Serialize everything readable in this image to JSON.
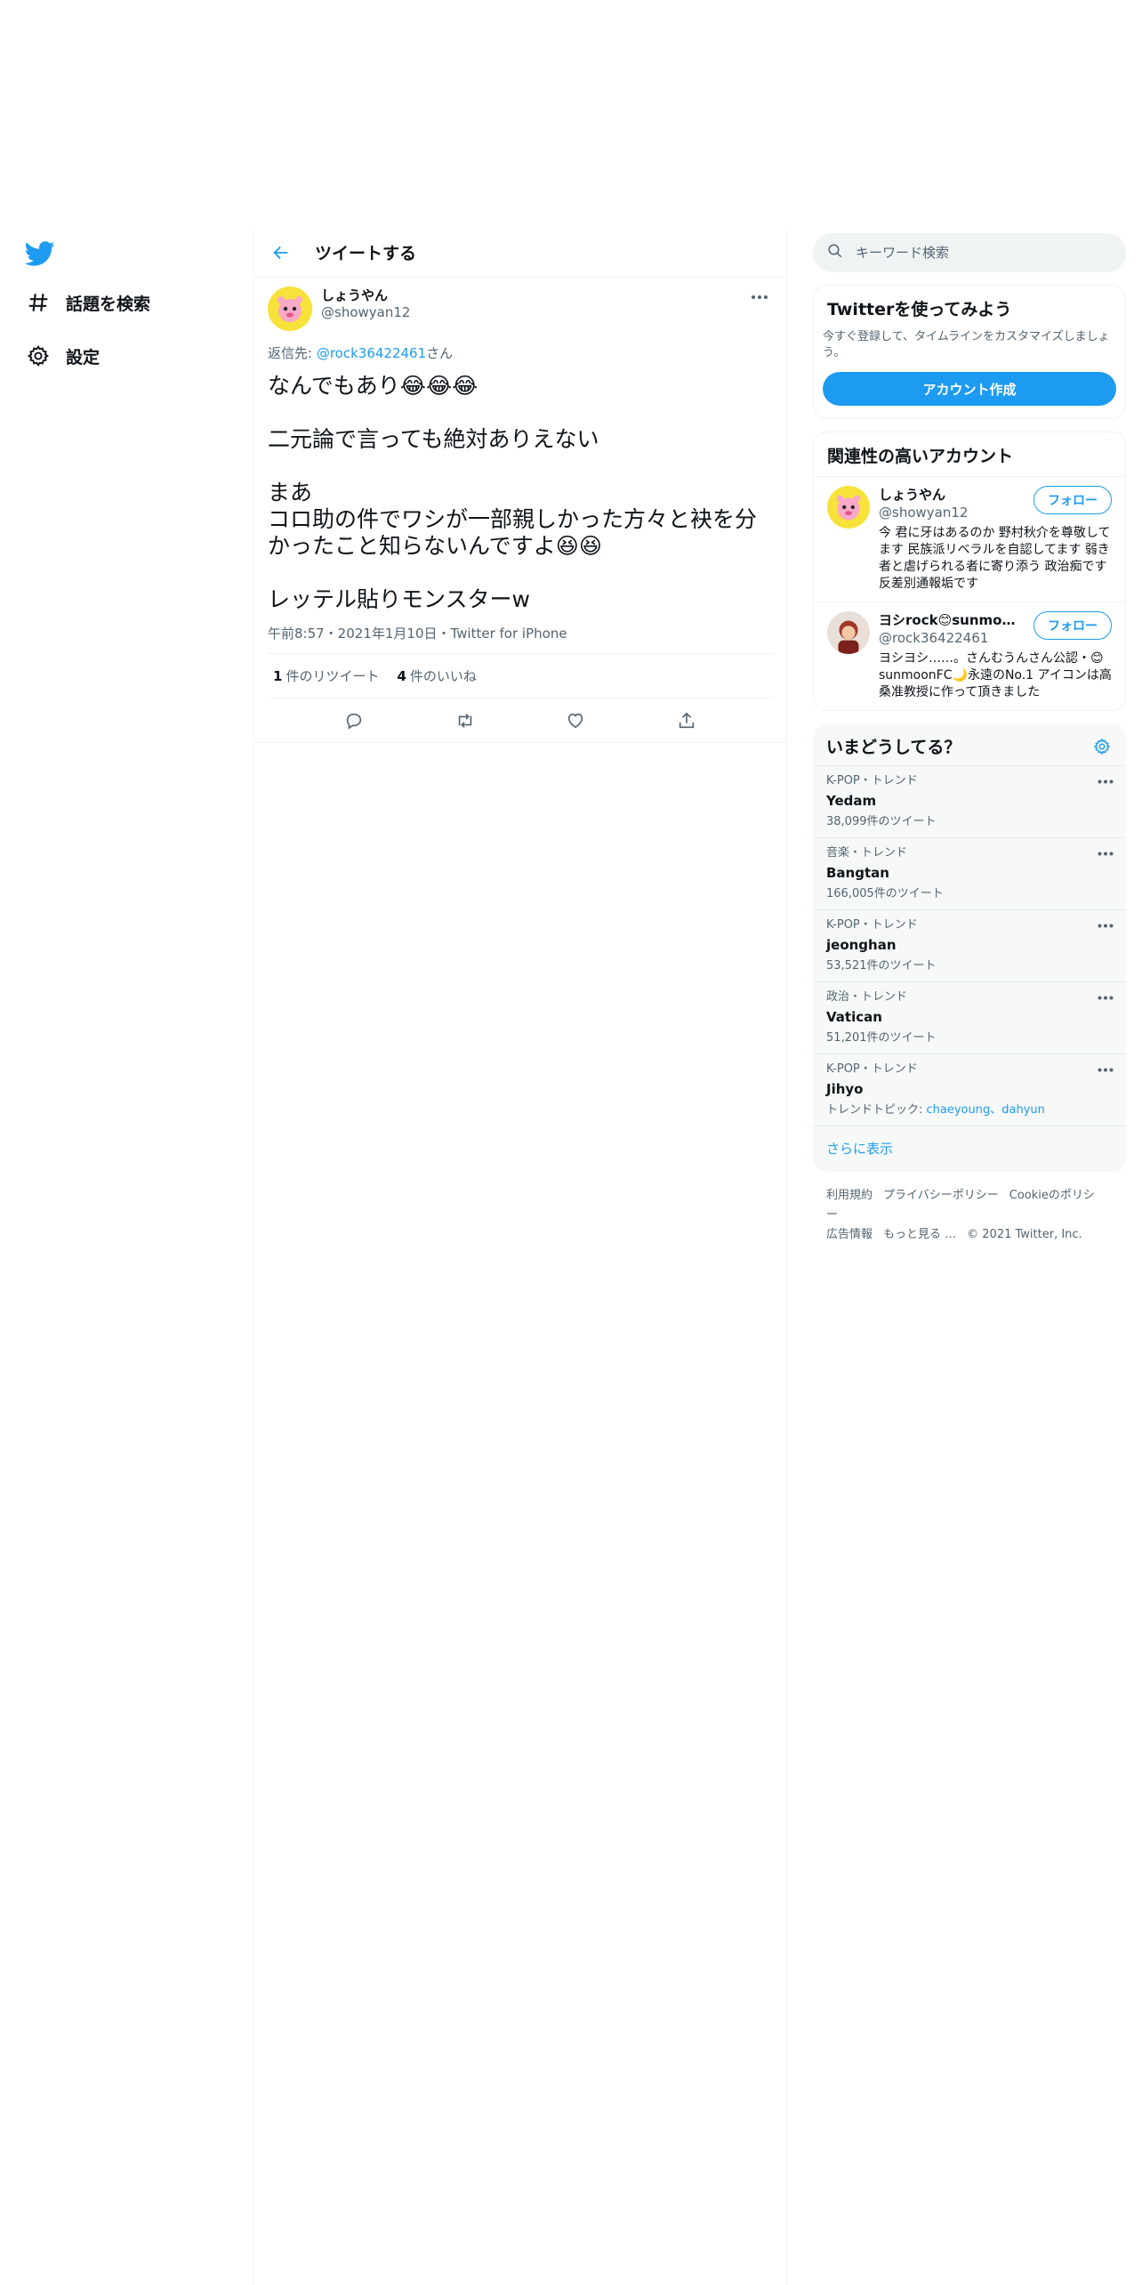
{
  "nav": {
    "items": [
      {
        "label": "話題を検索",
        "icon": "hashtag-icon"
      },
      {
        "label": "設定",
        "icon": "gear-icon"
      }
    ]
  },
  "header": {
    "title": "ツイートする"
  },
  "tweet": {
    "author_name": "しょうやん",
    "author_handle": "@showyan12",
    "reply_prefix": "返信先: ",
    "reply_handle": "@rock36422461",
    "reply_suffix": "さん",
    "text": "なんでもあり😂😂😂\n\n二元論で言っても絶対ありえない\n\nまあ\nコロ助の件でワシが一部親しかった方々と袂を分かったこと知らないんですよ😆😆\n\nレッテル貼りモンスターw",
    "meta": "午前8:57・2021年1月10日・Twitter for iPhone",
    "retweets_count": "1",
    "retweets_label": "件のリツイート",
    "likes_count": "4",
    "likes_label": "件のいいね"
  },
  "search": {
    "placeholder": "キーワード検索"
  },
  "signup": {
    "title": "Twitterを使ってみよう",
    "subtitle": "今すぐ登録して、タイムラインをカスタマイズしましょう。",
    "button": "アカウント作成"
  },
  "related": {
    "title": "関連性の高いアカウント",
    "accounts": [
      {
        "name": "しょうやん",
        "handle": "@showyan12",
        "follow": "フォロー",
        "bio": "今 君に牙はあるのか 野村秋介を尊敬してます 民族派リベラルを自認してます 弱き者と虐げられる者に寄り添う 政治痴です 反差別通報垢です"
      },
      {
        "name": "ヨシrock😊sunmoon…",
        "handle": "@rock36422461",
        "follow": "フォロー",
        "bio": "ヨシヨシ……。さんむうんさん公認・😊sunmoonFC🌙永遠のNo.1 アイコンは高桑准教授に作って頂きました"
      }
    ]
  },
  "trends": {
    "title": "いまどうしてる？",
    "items": [
      {
        "context": "K-POP・トレンド",
        "name": "Yedam",
        "count": "38,099件のツイート"
      },
      {
        "context": "音楽・トレンド",
        "name": "Bangtan",
        "count": "166,005件のツイート"
      },
      {
        "context": "K-POP・トレンド",
        "name": "jeonghan",
        "count": "53,521件のツイート"
      },
      {
        "context": "政治・トレンド",
        "name": "Vatican",
        "count": "51,201件のツイート"
      },
      {
        "context": "K-POP・トレンド",
        "name": "Jihyo",
        "topic_label": "トレンドトピック: ",
        "topic_tags": "chaeyoung、dahyun"
      }
    ],
    "show_more": "さらに表示"
  },
  "footer": {
    "links": [
      "利用規約",
      "プライバシーポリシー",
      "Cookieのポリシー",
      "広告情報",
      "もっと見る …"
    ],
    "copyright": "© 2021 Twitter, Inc."
  },
  "colors": {
    "accent": "#1d9bf0",
    "text": "#0f1419",
    "muted": "#536471"
  }
}
